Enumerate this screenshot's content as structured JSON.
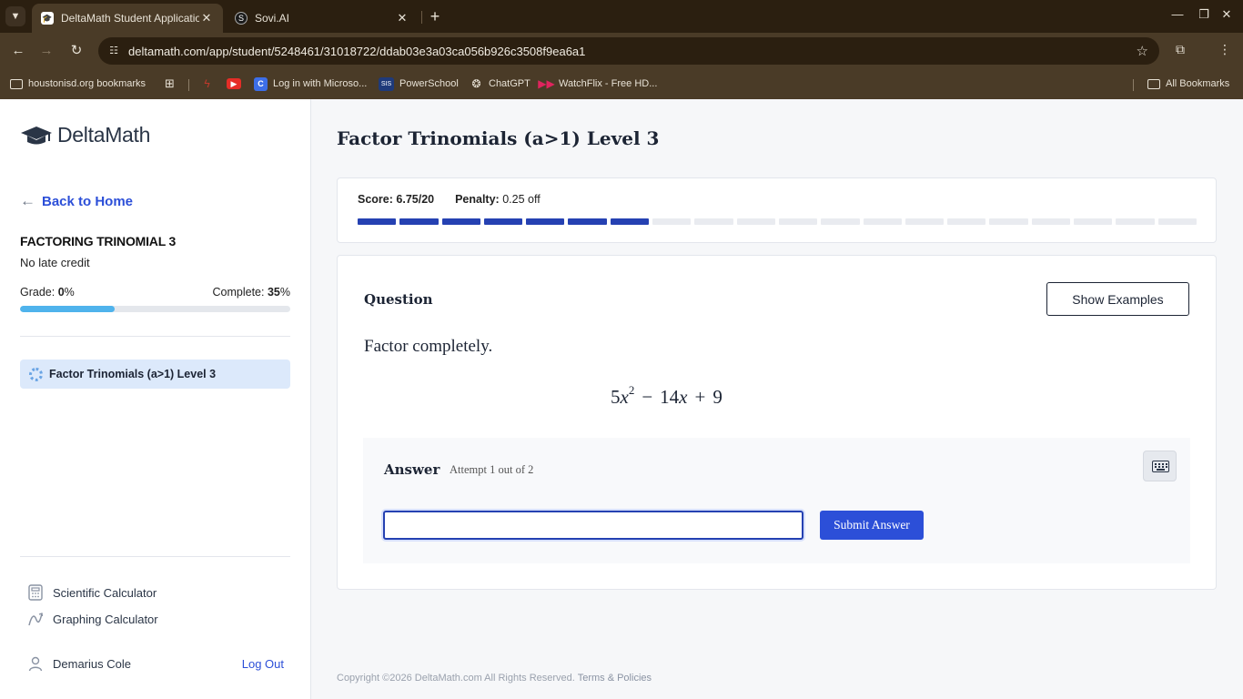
{
  "browser": {
    "tabs": [
      {
        "title": "DeltaMath Student Application",
        "active": true
      },
      {
        "title": "Sovi.AI",
        "active": false
      }
    ],
    "url": "deltamath.com/app/student/5248461/31018722/ddab03e3a03ca056b926c3508f9ea6a1",
    "bookmarks": [
      {
        "label": "houstonisd.org bookmarks",
        "icon": "folder-icon"
      },
      {
        "label": "",
        "icon": "apps-grid-icon"
      },
      {
        "label": "",
        "icon": "deltamath-bookmark-icon"
      },
      {
        "label": "",
        "icon": "youtube-icon"
      },
      {
        "label": "Log in with Microso...",
        "icon": "clever-icon"
      },
      {
        "label": "PowerSchool",
        "icon": "sis-icon"
      },
      {
        "label": "ChatGPT",
        "icon": "chatgpt-icon"
      },
      {
        "label": "WatchFlix - Free HD...",
        "icon": "watchflix-icon"
      }
    ],
    "all_bookmarks": "All Bookmarks"
  },
  "sidebar": {
    "logo_text": "DeltaMath",
    "back_label": "Back to Home",
    "assignment_title": "FACTORING TRINOMIAL 3",
    "late_credit": "No late credit",
    "grade_label": "Grade:",
    "grade_value": "0",
    "grade_unit": "%",
    "complete_label": "Complete:",
    "complete_value": "35",
    "complete_unit": "%",
    "complete_fraction": 0.35,
    "skills": [
      {
        "label": "Factor Trinomials (a>1) Level 3",
        "selected": true
      }
    ],
    "tools": [
      {
        "label": "Scientific Calculator",
        "icon": "calculator-icon"
      },
      {
        "label": "Graphing Calculator",
        "icon": "graph-icon"
      }
    ],
    "user_name": "Demarius Cole",
    "logout_label": "Log Out"
  },
  "main": {
    "title": "Factor Trinomials (a>1) Level 3",
    "score_label": "Score:",
    "score_value": "6.75/20",
    "penalty_label": "Penalty:",
    "penalty_value": "0.25 off",
    "progress_total_segments": 20,
    "progress_filled_segments": 7,
    "question_label": "Question",
    "show_examples": "Show Examples",
    "prompt": "Factor completely.",
    "expression": {
      "coef": "5",
      "var": "x",
      "exp": "2",
      "op1": "−",
      "term2": "14",
      "var2": "x",
      "op2": "+",
      "const": "9"
    },
    "answer_label": "Answer",
    "attempt_text": "Attempt 1 out of 2",
    "answer_value": "",
    "submit_label": "Submit Answer",
    "footer_text": "Copyright ©2026 DeltaMath.com All Rights Reserved.",
    "footer_link": "Terms & Policies"
  },
  "colors": {
    "accent": "#2c4fd8",
    "progress_on": "#2541b2",
    "grade_bar": "#4fb3ec",
    "chrome_dark": "#2b1f10",
    "chrome_mid": "#4a3b27"
  }
}
